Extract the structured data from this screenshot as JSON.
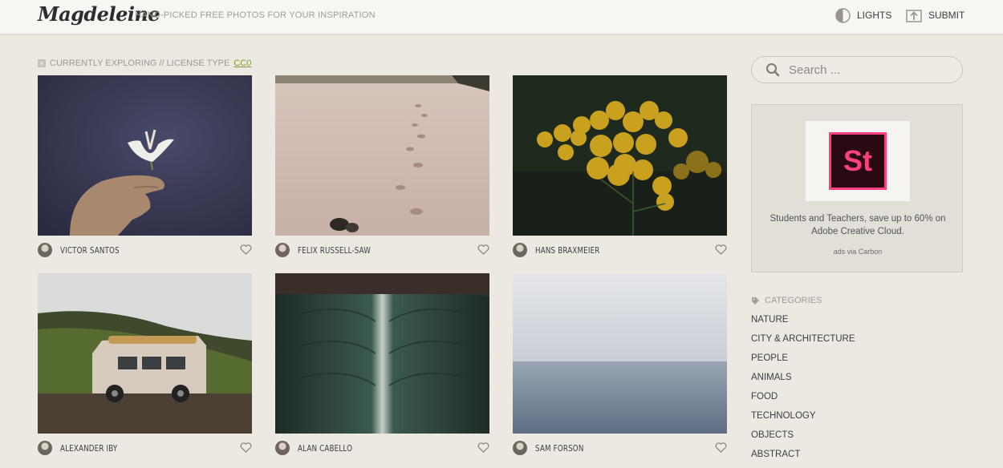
{
  "header": {
    "logo": "Magdeleine",
    "tagline": "HAND-PICKED FREE PHOTOS FOR YOUR INSPIRATION",
    "lights_label": "LIGHTS",
    "submit_label": "SUBMIT"
  },
  "filter": {
    "prefix": "CURRENTLY EXPLORING // LICENSE TYPE",
    "license": "CC0"
  },
  "photos": [
    {
      "author": "VICTOR SANTOS",
      "subject": "hand holding white flower"
    },
    {
      "author": "FELIX RUSSELL-SAW",
      "subject": "footprints on sandy beach"
    },
    {
      "author": "HANS BRAXMEIER",
      "subject": "yellow tansy flowers"
    },
    {
      "author": "ALEXANDER IBY",
      "subject": "camper van with kayak on hillside"
    },
    {
      "author": "ALAN CABELLO",
      "subject": "close-up of green leaf"
    },
    {
      "author": "SAM FORSON",
      "subject": "misty sea horizon"
    }
  ],
  "sidebar": {
    "search_placeholder": "Search ...",
    "ad": {
      "logo_text": "St",
      "text": "Students and Teachers, save up to 60% on Adobe Creative Cloud.",
      "via": "ads via Carbon"
    },
    "categories_heading": "CATEGORIES",
    "categories": [
      "NATURE",
      "CITY & ARCHITECTURE",
      "PEOPLE",
      "ANIMALS",
      "FOOD",
      "TECHNOLOGY",
      "OBJECTS",
      "ABSTRACT"
    ]
  },
  "colors": {
    "background": "#ece9e3",
    "header": "#f7f6f2",
    "license_link": "#7f9a2e",
    "ad_accent": "#ff3f7e"
  }
}
